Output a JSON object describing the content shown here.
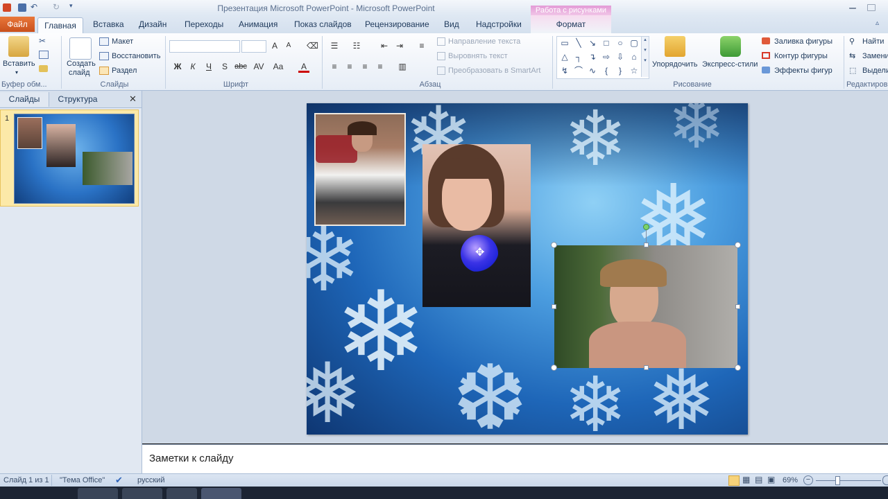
{
  "window": {
    "title": "Презентация Microsoft PowerPoint  -  Microsoft PowerPoint",
    "context_header": "Работа с рисунками"
  },
  "tabs": {
    "file": "Файл",
    "items": [
      "Главная",
      "Вставка",
      "Дизайн",
      "Переходы",
      "Анимация",
      "Показ слайдов",
      "Рецензирование",
      "Вид",
      "Надстройки"
    ],
    "format": "Формат"
  },
  "ribbon": {
    "clipboard": {
      "paste": "Вставить",
      "label": "Буфер обм..."
    },
    "slides": {
      "create_line1": "Создать",
      "create_line2": "слайд",
      "layout": "Макет",
      "reset": "Восстановить",
      "section": "Раздел",
      "label": "Слайды"
    },
    "font": {
      "label": "Шрифт",
      "buttons": [
        "Ж",
        "К",
        "Ч",
        "S",
        "abc",
        "AV",
        "Aa",
        "A"
      ]
    },
    "paragraph": {
      "text_direction": "Направление текста",
      "align_text": "Выровнять текст",
      "smartart": "Преобразовать в SmartArt",
      "label": "Абзац"
    },
    "drawing": {
      "arrange": "Упорядочить",
      "quick_styles": "Экспресс-стили",
      "fill": "Заливка фигуры",
      "outline": "Контур фигуры",
      "effects": "Эффекты фигур",
      "label": "Рисование"
    },
    "editing": {
      "find": "Найти",
      "replace": "Замени",
      "select": "Выдели",
      "label": "Редактиров"
    }
  },
  "left_pane": {
    "tab_slides": "Слайды",
    "tab_outline": "Структура",
    "slide_number": "1"
  },
  "notes": {
    "placeholder": "Заметки к слайду"
  },
  "status": {
    "slide": "Слайд 1 из 1",
    "theme": "\"Тема Office\"",
    "language": "русский",
    "zoom": "69%"
  },
  "colors": {
    "file_tab": "#d9622b",
    "context": "#e8a6da",
    "snow_bg": "#1e66b8"
  }
}
